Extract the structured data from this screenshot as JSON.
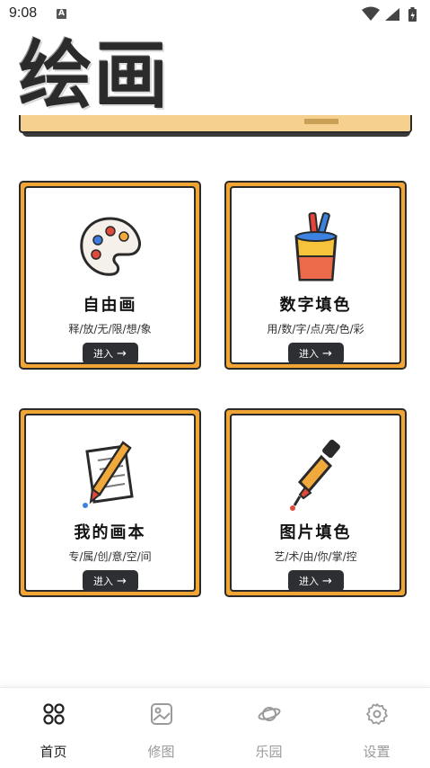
{
  "status_bar": {
    "time": "9:08",
    "notif_letter": "A"
  },
  "banner": {
    "title": "绘画"
  },
  "cards": [
    {
      "title": "自由画",
      "subtitle": "释/放/无/限/想/象",
      "button": "进入",
      "icon": "palette-icon"
    },
    {
      "title": "数字填色",
      "subtitle": "用/数/字/点/亮/色/彩",
      "button": "进入",
      "icon": "paint-bucket-icon"
    },
    {
      "title": "我的画本",
      "subtitle": "专/属/创/意/空/间",
      "button": "进入",
      "icon": "pencil-note-icon"
    },
    {
      "title": "图片填色",
      "subtitle": "艺/术/由/你/掌/控",
      "button": "进入",
      "icon": "dropper-icon"
    }
  ],
  "nav": [
    {
      "label": "首页",
      "icon": "home-grid-icon",
      "active": true
    },
    {
      "label": "修图",
      "icon": "image-icon",
      "active": false
    },
    {
      "label": "乐园",
      "icon": "planet-icon",
      "active": false
    },
    {
      "label": "设置",
      "icon": "gear-icon",
      "active": false
    }
  ],
  "colors": {
    "card_bg": "#f1a534",
    "button_bg": "#2d2f33",
    "nav_active": "#222222",
    "nav_inactive": "#9a9a9a"
  }
}
